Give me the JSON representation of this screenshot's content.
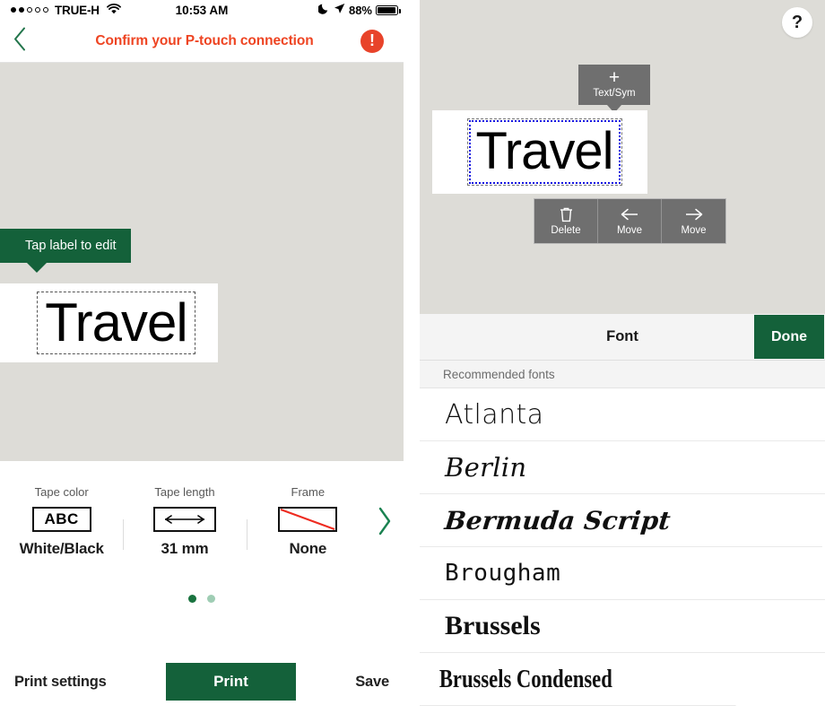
{
  "left": {
    "status_bar": {
      "signal_dots_filled": 2,
      "signal_dots_total": 5,
      "carrier": "TRUE-H",
      "wifi_icon": "wifi-icon",
      "time": "10:53 AM",
      "moon_icon": "moon-icon",
      "location_icon": "location-arrow-icon",
      "battery_percent": "88%",
      "battery_icon": "battery-icon"
    },
    "nav": {
      "back_icon": "chevron-left-icon",
      "title": "Confirm your P-touch connection",
      "alert_icon": "alert-exclamation-icon",
      "alert_glyph": "!"
    },
    "canvas": {
      "tooltip": "Tap label to edit",
      "label_text": "Travel"
    },
    "settings": [
      {
        "title": "Tape color",
        "icon": "tape-color-icon",
        "icon_text": "ABC",
        "value": "White/Black"
      },
      {
        "title": "Tape length",
        "icon": "tape-length-icon",
        "icon_text": "",
        "value": "31 mm"
      },
      {
        "title": "Frame",
        "icon": "frame-none-icon",
        "icon_text": "",
        "value": "None"
      }
    ],
    "next_icon": "chevron-right-icon",
    "pager": {
      "total": 2,
      "active_index": 0
    },
    "bottom": {
      "print_settings_label": "Print settings",
      "print_label": "Print",
      "save_label": "Save"
    }
  },
  "right": {
    "help_icon": "question-mark-icon",
    "help_glyph": "?",
    "text_sym": {
      "plus": "+",
      "label": "Text/Sym"
    },
    "label_text": "Travel",
    "object_toolbar": [
      {
        "icon": "trash-icon",
        "label": "Delete"
      },
      {
        "icon": "arrow-left-icon",
        "label": "Move"
      },
      {
        "icon": "arrow-right-icon",
        "label": "Move"
      }
    ],
    "font_panel": {
      "title": "Font",
      "done_label": "Done",
      "section_header": "Recommended fonts",
      "fonts": [
        {
          "name": "Atlanta"
        },
        {
          "name": "Berlin"
        },
        {
          "name": "Bermuda Script"
        },
        {
          "name": "Brougham"
        },
        {
          "name": "Brussels"
        },
        {
          "name": "Brussels Condensed"
        }
      ]
    }
  },
  "colors": {
    "brand_green": "#14613a",
    "alert_red": "#e8432a",
    "nav_title_red": "#ee4422",
    "canvas_gray": "#dddcd7",
    "toolbar_gray": "#6f6f6f",
    "selection_blue": "#1414e0"
  }
}
